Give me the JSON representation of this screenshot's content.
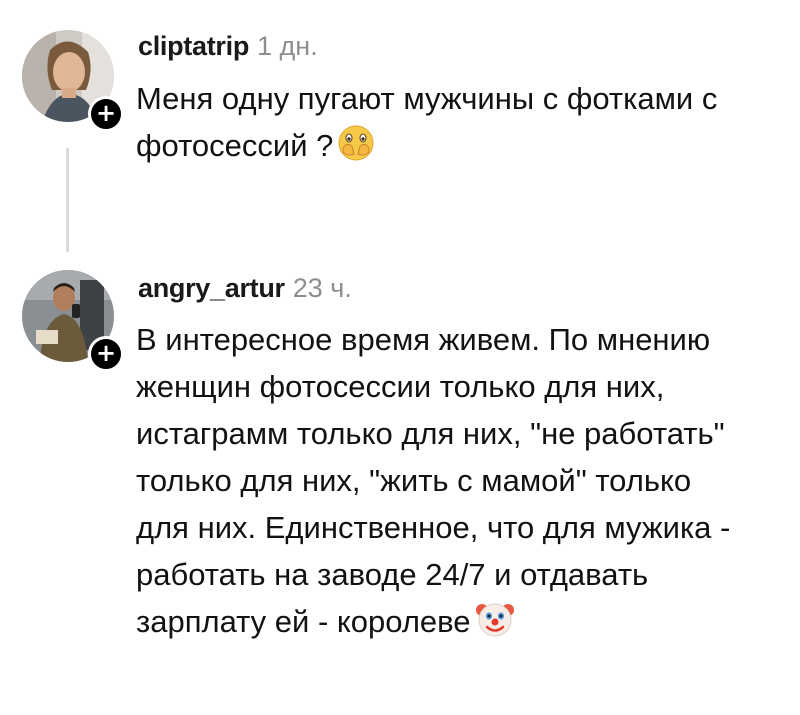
{
  "comments": [
    {
      "username": "cliptatrip",
      "timestamp": "1 дн.",
      "avatar": "user-avatar-woman",
      "follow_icon": "+",
      "lines": [
        "Меня одну пугают мужчины с фотками с",
        "фотосессий ?"
      ],
      "emoji": "face-with-hand-over-mouth-emoji"
    },
    {
      "username": "angry_artur",
      "timestamp": "23 ч.",
      "avatar": "user-avatar-man-selfie",
      "follow_icon": "+",
      "lines": [
        "В интересное время живем. По мнению",
        "женщин фотосессии только для них,",
        "истаграмм только для них, \"не работать\"",
        "только для них, \"жить с мамой\" только",
        "для них. Единственное, что для мужика -",
        "работать на заводе 24/7 и отдавать",
        "зарплату ей - королеве"
      ],
      "emoji": "clown-face-emoji"
    }
  ],
  "colors": {
    "background": "#ffffff",
    "text": "#121212",
    "timestamp": "#8e8e8e",
    "badge": "#000000",
    "thread_line": "#dbdbdb"
  }
}
